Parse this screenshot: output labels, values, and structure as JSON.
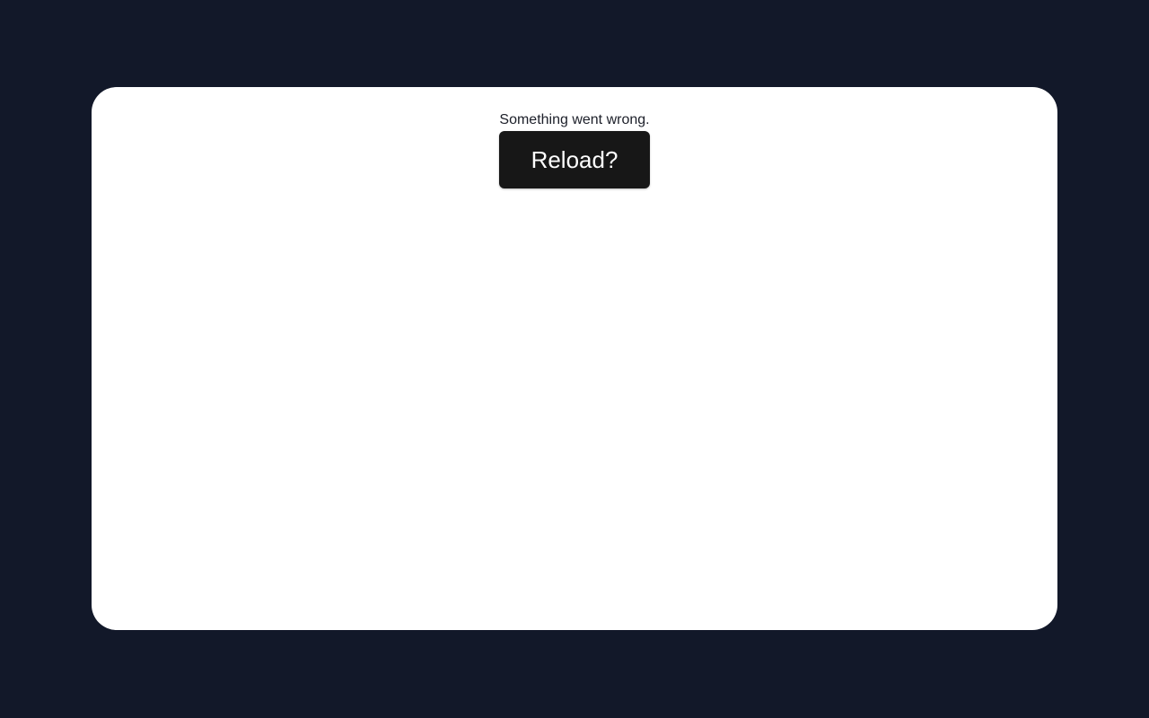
{
  "error": {
    "message": "Something went wrong.",
    "reload_label": "Reload?"
  },
  "colors": {
    "page_background": "#121829",
    "card_background": "#ffffff",
    "button_background": "#171717",
    "button_text": "#ffffff",
    "message_text": "#1c1f29"
  }
}
